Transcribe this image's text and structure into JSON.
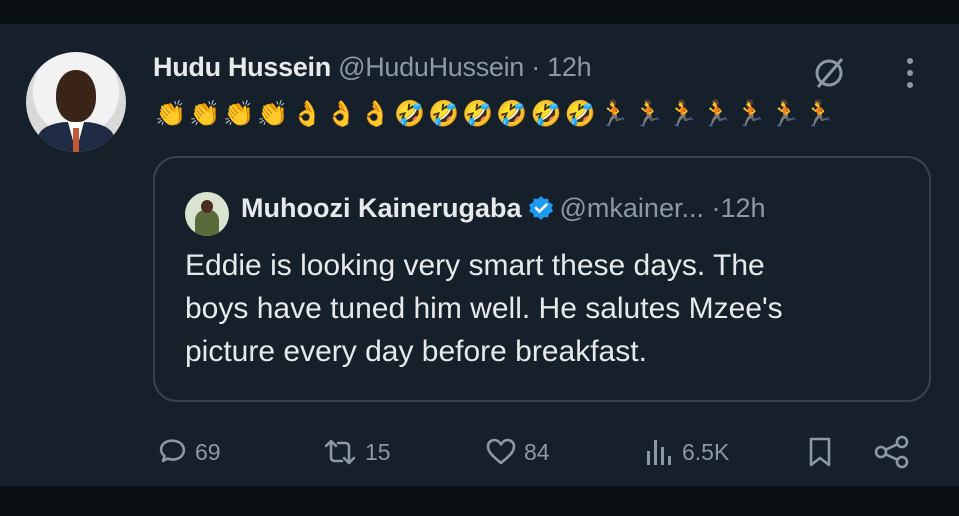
{
  "author": {
    "name": "Hudu Hussein",
    "handle": "@HuduHussein",
    "separator": "·",
    "time": "12h"
  },
  "emojis": [
    "👏",
    "👏",
    "👏",
    "👏",
    "👌",
    "👌",
    "👌",
    "🤣",
    "🤣",
    "🤣",
    "🤣",
    "🤣",
    "🤣",
    "🏃",
    "🏃",
    "🏃",
    "🏃",
    "🏃",
    "🏃",
    "🏃"
  ],
  "quoted": {
    "name": "Muhoozi Kainerugaba",
    "handle": "@mkainer...",
    "separator": "·",
    "time": "12h",
    "text_lines": [
      "Eddie is looking very smart these days. The",
      "boys have tuned him well. He salutes Mzee's",
      "picture every day before breakfast."
    ]
  },
  "actions": {
    "replies": "69",
    "reposts": "15",
    "likes": "84",
    "views": "6.5K"
  },
  "icons": {
    "grok": "grok-icon",
    "more": "more-icon",
    "verified": "verified-badge-icon",
    "reply": "reply-icon",
    "repost": "repost-icon",
    "like": "heart-icon",
    "views": "views-chart-icon",
    "bookmark": "bookmark-icon",
    "share": "share-icon"
  },
  "colors": {
    "background": "#15202b",
    "text": "#e7e9ea",
    "muted": "#8b98a5",
    "border": "#38444d",
    "verified": "#1d9bf0"
  }
}
